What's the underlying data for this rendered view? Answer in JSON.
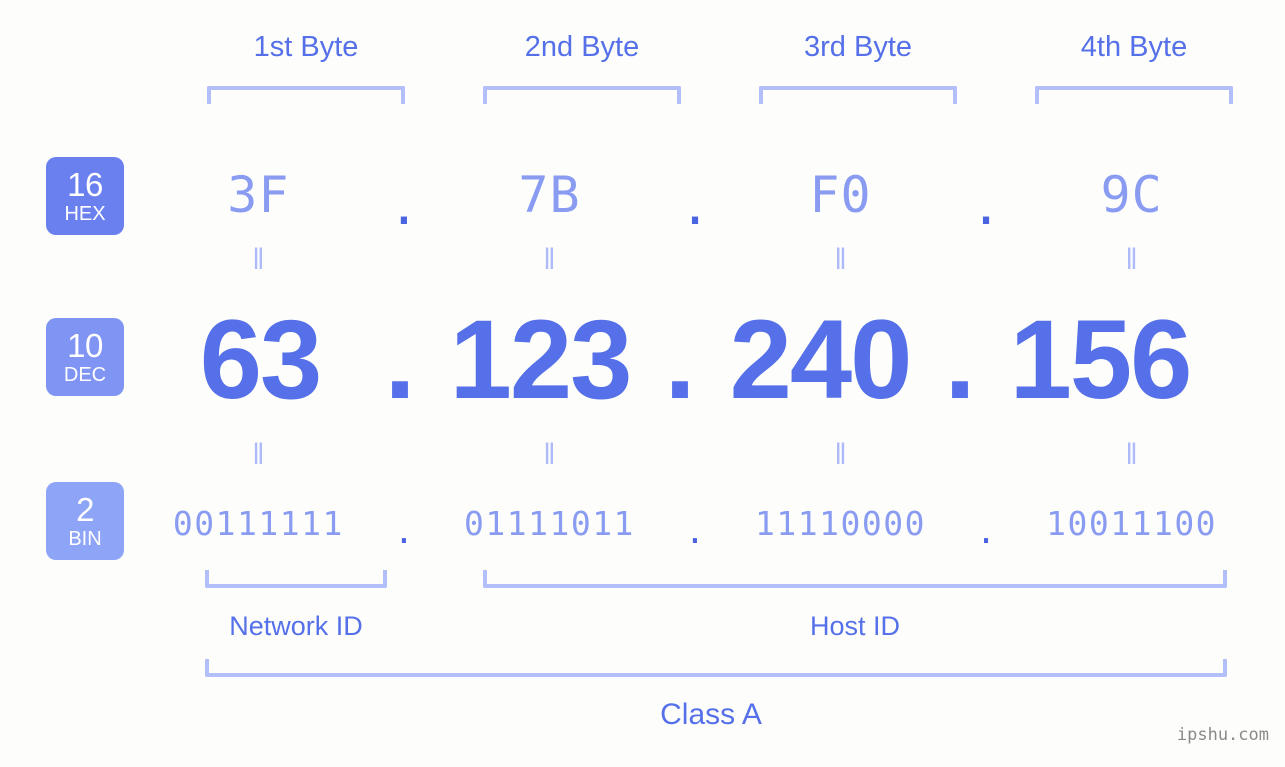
{
  "background_color": "#fdfefb",
  "accent_color": "#5570e8",
  "light_accent_color": "#8a9cf2",
  "bracket_color": "#b3bffa",
  "byte_headers": [
    {
      "label": "1st Byte"
    },
    {
      "label": "2nd Byte"
    },
    {
      "label": "3rd Byte"
    },
    {
      "label": "4th Byte"
    }
  ],
  "bases": [
    {
      "number": "16",
      "name": "HEX",
      "color": "#6b80ef"
    },
    {
      "number": "10",
      "name": "DEC",
      "color": "#8094f3"
    },
    {
      "number": "2",
      "name": "BIN",
      "color": "#8ea4f7"
    }
  ],
  "rows": {
    "hex": {
      "values": [
        "3F",
        "7B",
        "F0",
        "9C"
      ],
      "separator": "."
    },
    "dec": {
      "values": [
        "63",
        "123",
        "240",
        "156"
      ],
      "separator": "."
    },
    "bin": {
      "values": [
        "00111111",
        "01111011",
        "11110000",
        "10011100"
      ],
      "separator": "."
    }
  },
  "equals_mark": "‖",
  "regions": [
    {
      "label": "Network ID"
    },
    {
      "label": "Host ID"
    }
  ],
  "class": {
    "label": "Class A"
  },
  "watermark": {
    "text": "ipshu.com"
  }
}
